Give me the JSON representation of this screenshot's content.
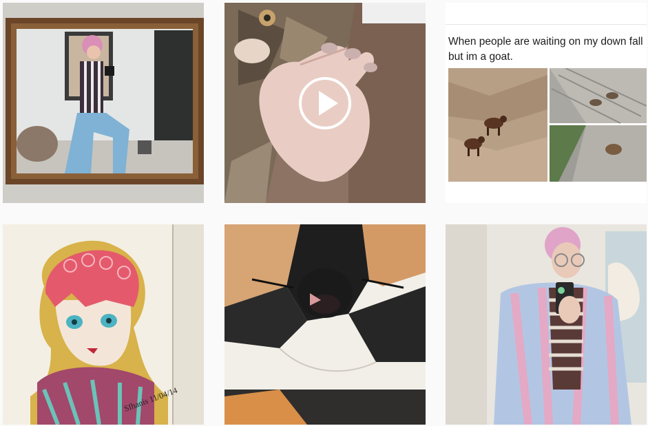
{
  "feed": {
    "posts": [
      {
        "kind": "photo",
        "subject": "mirror-selfie"
      },
      {
        "kind": "video",
        "subject": "cat-with-hand",
        "play_icon": "play-icon"
      },
      {
        "kind": "meme",
        "caption": "When people are waiting on my down fall but im a goat."
      },
      {
        "kind": "drawing",
        "subject": "pink-haired-character",
        "signature": "Sfhanis 11/04/14"
      },
      {
        "kind": "photo",
        "subject": "calico-cat-closeup"
      },
      {
        "kind": "photo",
        "subject": "selfie-pastel-coat"
      }
    ]
  },
  "colors": {
    "page_background": "#fafafa",
    "play_overlay": "#ffffff"
  }
}
